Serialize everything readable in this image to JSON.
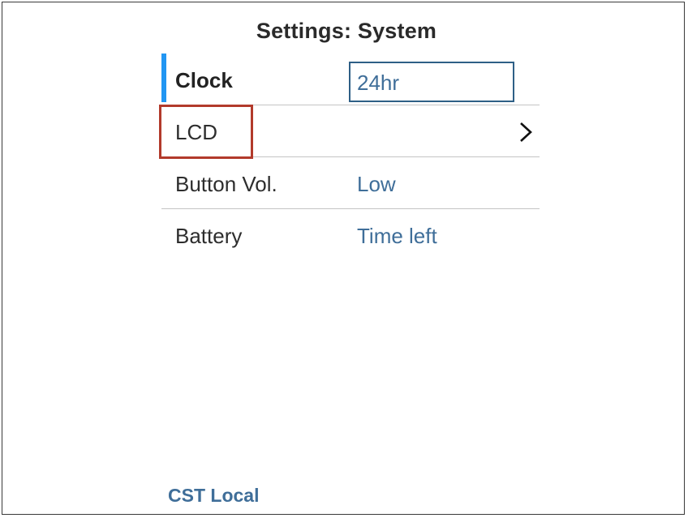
{
  "header": {
    "title": "Settings: System"
  },
  "menu": {
    "items": [
      {
        "label": "Clock",
        "value": "24hr"
      },
      {
        "label": "LCD",
        "value": ""
      },
      {
        "label": "Button Vol.",
        "value": "Low"
      },
      {
        "label": "Battery",
        "value": "Time left"
      }
    ]
  },
  "footer": {
    "timezone": "CST Local"
  },
  "colors": {
    "accent": "#2196f3",
    "value_text": "#3f6e99",
    "input_border": "#2e5f86",
    "highlight": "#b23a2b"
  },
  "icons": {
    "lcd_row": "chevron-right-icon"
  }
}
